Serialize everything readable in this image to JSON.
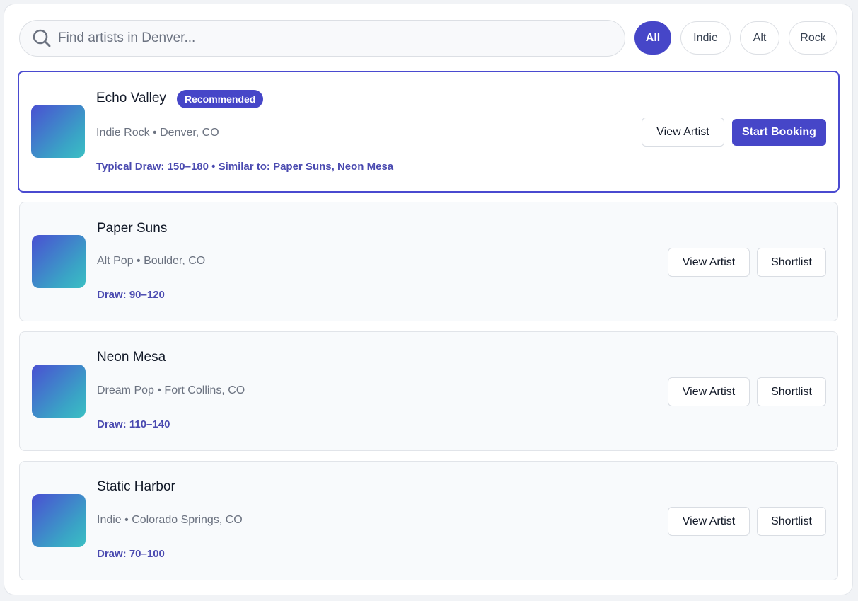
{
  "search": {
    "placeholder": "Find artists in Denver..."
  },
  "filters": [
    {
      "label": "All",
      "active": true
    },
    {
      "label": "Indie",
      "active": false
    },
    {
      "label": "Alt",
      "active": false
    },
    {
      "label": "Rock",
      "active": false
    }
  ],
  "artists": [
    {
      "name": "Echo Valley",
      "badge": "Recommended",
      "meta": "Indie Rock • Denver, CO",
      "draw": "Typical Draw: 150–180 • Similar to: Paper Suns, Neon Mesa",
      "view_label": "View Artist",
      "action_label": "Start Booking",
      "selected": true
    },
    {
      "name": "Paper Suns",
      "meta": "Alt Pop • Boulder, CO",
      "draw": "Draw: 90–120",
      "view_label": "View Artist",
      "action_label": "Shortlist"
    },
    {
      "name": "Neon Mesa",
      "meta": "Dream Pop • Fort Collins, CO",
      "draw": "Draw: 110–140",
      "view_label": "View Artist",
      "action_label": "Shortlist"
    },
    {
      "name": "Static Harbor",
      "meta": "Indie • Colorado Springs, CO",
      "draw": "Draw: 70–100",
      "view_label": "View Artist",
      "action_label": "Shortlist"
    }
  ],
  "colors": {
    "accent": "#4646c8",
    "thumb_start": "#4a4fd2",
    "thumb_end": "#3bbfc4"
  },
  "icons": {
    "search": "search-icon"
  }
}
